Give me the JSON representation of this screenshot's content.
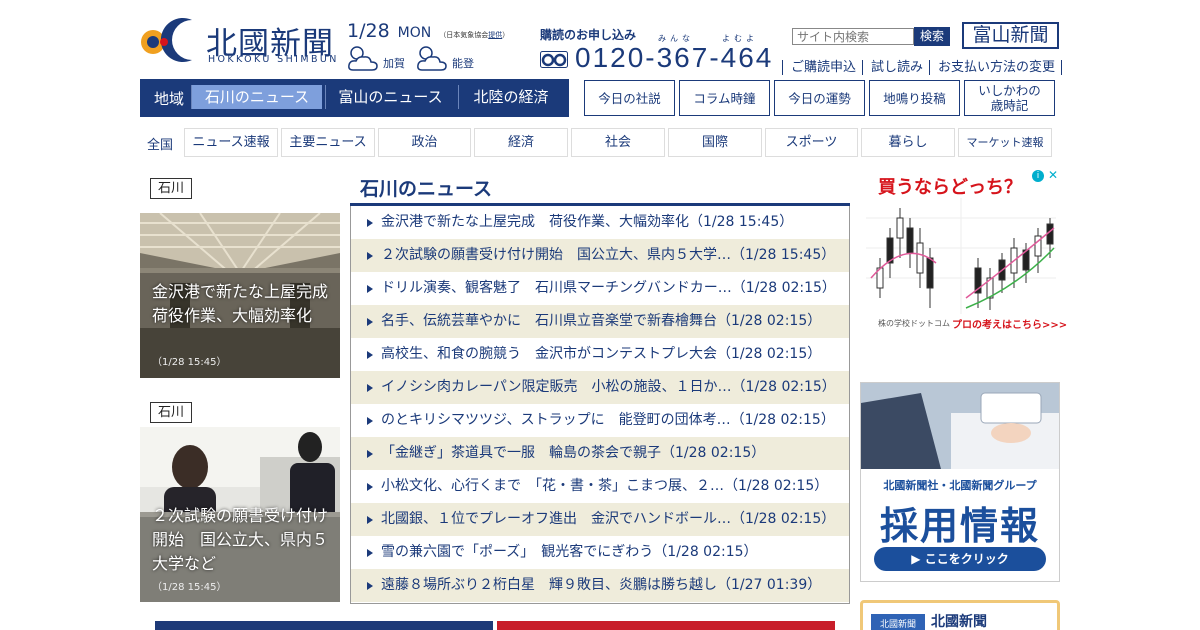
{
  "header": {
    "logo_ja": "北國新聞",
    "logo_en": "HOKKOKU SHIMBUN",
    "date": "1/28",
    "weekday": "MON",
    "weather_source_prefix": "（日本気象協会",
    "weather_source_link": "提供",
    "weather_source_suffix": "）",
    "weather": [
      {
        "area": "加賀",
        "icon": "cloud-sun-icon"
      },
      {
        "area": "能登",
        "icon": "cloud-sun-icon"
      }
    ],
    "subscribe_title": "購読のお申し込み",
    "ruby_1": "みんな",
    "ruby_2": "よむよ",
    "phone": "0120-367-464",
    "search_placeholder": "サイト内検索",
    "search_button": "検索",
    "toyama_button": "富山新聞",
    "top_links": [
      "ご購読申込",
      "試し読み",
      "お支払い方法の変更"
    ]
  },
  "region_nav": {
    "label": "地域",
    "tabs": [
      {
        "label": "石川のニュース",
        "active": true
      },
      {
        "label": "富山のニュース",
        "active": false
      },
      {
        "label": "北陸の経済",
        "active": false
      }
    ]
  },
  "quick_buttons": [
    "今日の社説",
    "コラム時鐘",
    "今日の運勢",
    "地鳴り投稿",
    "いしかわの\n歳時記"
  ],
  "categories": {
    "label": "全国",
    "items": [
      "ニュース速報",
      "主要ニュース",
      "政治",
      "経済",
      "社会",
      "国際",
      "スポーツ",
      "暮らし",
      "マーケット速報"
    ]
  },
  "photo_stories": [
    {
      "tag": "石川",
      "caption": "金沢港で新たな上屋完成　荷役作業、大幅効率化",
      "time": "（1/28 15:45）"
    },
    {
      "tag": "石川",
      "caption": "２次試験の願書受け付け開始　国公立大、県内５大学など",
      "time": "（1/28 15:45）"
    }
  ],
  "news_section": {
    "title": "石川のニュース",
    "items": [
      "金沢港で新たな上屋完成　荷役作業、大幅効率化（1/28 15:45）",
      "２次試験の願書受け付け開始　国公立大、県内５大学…（1/28 15:45）",
      "ドリル演奏、観客魅了　石川県マーチングバンドカー…（1/28 02:15）",
      "名手、伝統芸華やかに　石川県立音楽堂で新春檜舞台（1/28 02:15）",
      "高校生、和食の腕競う　金沢市がコンテストプレ大会（1/28 02:15）",
      "イノシシ肉カレーパン限定販売　小松の施設、１日か…（1/28 02:15）",
      "のとキリシマツツジ、ストラップに　能登町の団体考…（1/28 02:15）",
      "「金継ぎ」茶道具で一服　輪島の茶会で親子（1/28 02:15）",
      "小松文化、心行くまで　「花・書・茶」こまつ展、２…（1/28 02:15）",
      "北國銀、１位でプレーオフ進出　金沢でハンドボール…（1/28 02:15）",
      "雪の兼六園で「ポーズ」　観光客でにぎわう（1/28 02:15）",
      "遠藤８場所ぶり２桁白星　輝９敗目、炎鵬は勝ち越し（1/27 01:39）"
    ]
  },
  "ads": {
    "stock": {
      "title": "買うならどっち？",
      "info": "i",
      "close": "✕",
      "footer_left": "株の学校ドットコム",
      "footer_right": "プロの考えはこちら>>>"
    },
    "recruit": {
      "line1": "北國新聞社・北國新聞グループ",
      "line2": "採用情報",
      "button": "▶ ここをクリック"
    },
    "paper": {
      "logo": "北國新聞",
      "text": "北國新聞"
    }
  },
  "colors": {
    "brand": "#1b3a7a",
    "active_tab": "#7e9fdc",
    "stripe": "#efecdb",
    "ad_red": "#d6141c"
  }
}
